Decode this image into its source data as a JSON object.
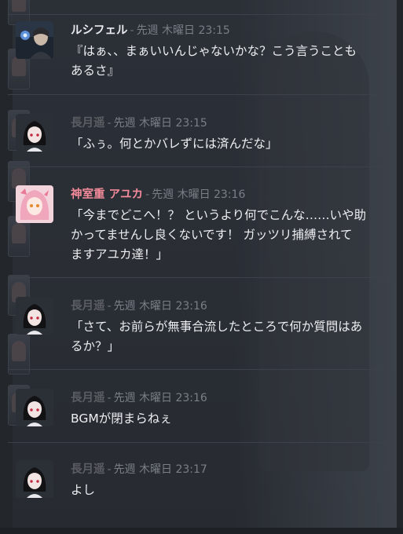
{
  "messages": [
    {
      "author": "ルシフェル",
      "separator": "-",
      "timestamp": "先週 木曜日 23:15",
      "lines": [
        "『はぁ、、まぁいいんじゃないかな？こう言うことも",
        "あるさ』"
      ],
      "avatar_icon": "lucifer-avatar"
    },
    {
      "author": "長月遥",
      "separator": "-",
      "timestamp": "先週 木曜日 23:15",
      "lines": [
        "「ふぅ。何とかバレずには済んだな」"
      ],
      "avatar_icon": "nagatsuki-avatar"
    },
    {
      "author": "神室重 アユカ",
      "separator": "-",
      "timestamp": "先週 木曜日 23:16",
      "lines": [
        "「今までどこへ！？ というより何でこんな……いや助",
        "かってませんし良くないです！ ガッツリ捕縛されて",
        "ますアユカ達！」"
      ],
      "avatar_icon": "ayuka-avatar"
    },
    {
      "author": "長月遥",
      "separator": "-",
      "timestamp": "先週 木曜日 23:16",
      "lines": [
        "「さて、お前らが無事合流したところで何か質問はあ",
        "るか？」"
      ],
      "avatar_icon": "nagatsuki-avatar"
    },
    {
      "author": "長月遥",
      "separator": "-",
      "timestamp": "先週 木曜日 23:16",
      "lines": [
        "BGMが閉まらねぇ"
      ],
      "avatar_icon": "nagatsuki-avatar"
    },
    {
      "author": "長月遥",
      "separator": "-",
      "timestamp": "先週 木曜日 23:17",
      "lines": [
        "よし"
      ],
      "avatar_icon": "nagatsuki-avatar"
    }
  ],
  "colors": {
    "background": "#2a2e35",
    "author_lucifer": "#e8eaed",
    "author_nagatsuki": "#5a5d62",
    "author_ayuka": "#f48b9a",
    "timestamp": "#7a7f86",
    "body_text": "#eceef0",
    "divider": "#3d424a"
  }
}
